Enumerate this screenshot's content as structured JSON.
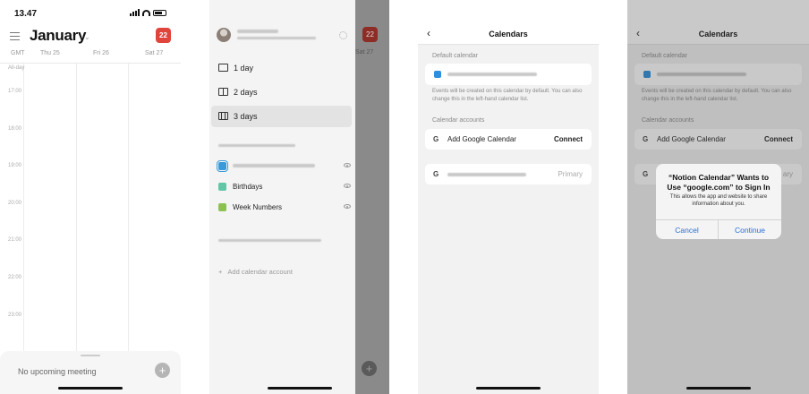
{
  "phone1": {
    "status_time": "13.47",
    "month": "January",
    "today_badge": "22",
    "gmt_label": "GMT",
    "days": [
      "Thu 25",
      "Fri 26",
      "Sat 27"
    ],
    "all_day_label": "All-day",
    "hours": [
      "17:00",
      "18:00",
      "19:00",
      "20:00",
      "21:00",
      "22:00",
      "23:00"
    ],
    "upcoming_text": "No upcoming meeting"
  },
  "phone2": {
    "views": [
      "1 day",
      "2 days",
      "3 days"
    ],
    "active_view": "3 days",
    "calendars": [
      {
        "label": "",
        "color": "#3a9ad9",
        "blurred": true
      },
      {
        "label": "Birthdays",
        "color": "#5fc7a6",
        "blurred": false
      },
      {
        "label": "Week Numbers",
        "color": "#8cc152",
        "blurred": false
      }
    ],
    "add_account": "Add calendar account",
    "behind_badge": "22",
    "behind_day": "Sat 27"
  },
  "phone3": {
    "title": "Calendars",
    "default_label": "Default calendar",
    "hint": "Events will be created on this calendar by default. You can also change this in the left-hand calendar list.",
    "accounts_label": "Calendar accounts",
    "add_google": "Add Google Calendar",
    "connect": "Connect",
    "primary": "Primary",
    "g_icon": "G"
  },
  "phone4": {
    "title": "Calendars",
    "default_label": "Default calendar",
    "hint": "Events will be created on this calendar by default. You can also change this in the left-hand calendar list.",
    "accounts_label": "Calendar accounts",
    "add_google": "Add Google Calendar",
    "connect": "Connect",
    "primary_partial": "ary",
    "g_icon": "G",
    "alert": {
      "title": "“Notion Calendar” Wants to Use “google.com” to Sign In",
      "message": "This allows the app and website to share information about you.",
      "cancel": "Cancel",
      "continue": "Continue"
    }
  }
}
